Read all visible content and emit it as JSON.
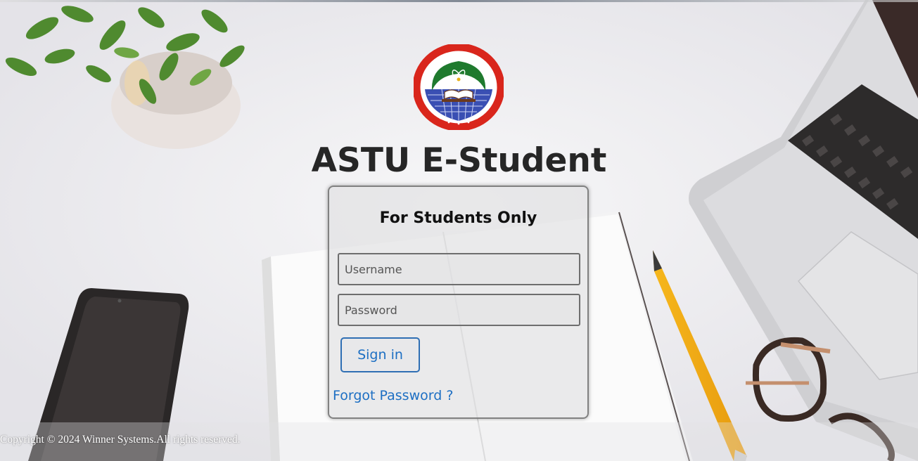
{
  "page": {
    "title": "ASTU E-Student"
  },
  "logo": {
    "name": "astu-university-seal",
    "ring_text_top": "አዳማ ሳይንስና ቴክኖሎጂ ዩኒቨርሲቲ",
    "ring_text_bottom": "ADAMA SCIENCE AND TECHNOLOGY UNIVERSITY",
    "colors": {
      "ring": "#d9261c",
      "globe": "#3a4fb3",
      "leaves": "#1f7a2e",
      "gold": "#e7b21a"
    }
  },
  "login": {
    "heading": "For Students Only",
    "username_placeholder": "Username",
    "password_placeholder": "Password",
    "signin_label": "Sign in",
    "forgot_label": "Forgot Password ?"
  },
  "footer": {
    "copyright": "Copyright © 2024 Winner Systems.All rights reserved."
  },
  "colors": {
    "accent": "#1d6fc3",
    "title": "#262626"
  }
}
